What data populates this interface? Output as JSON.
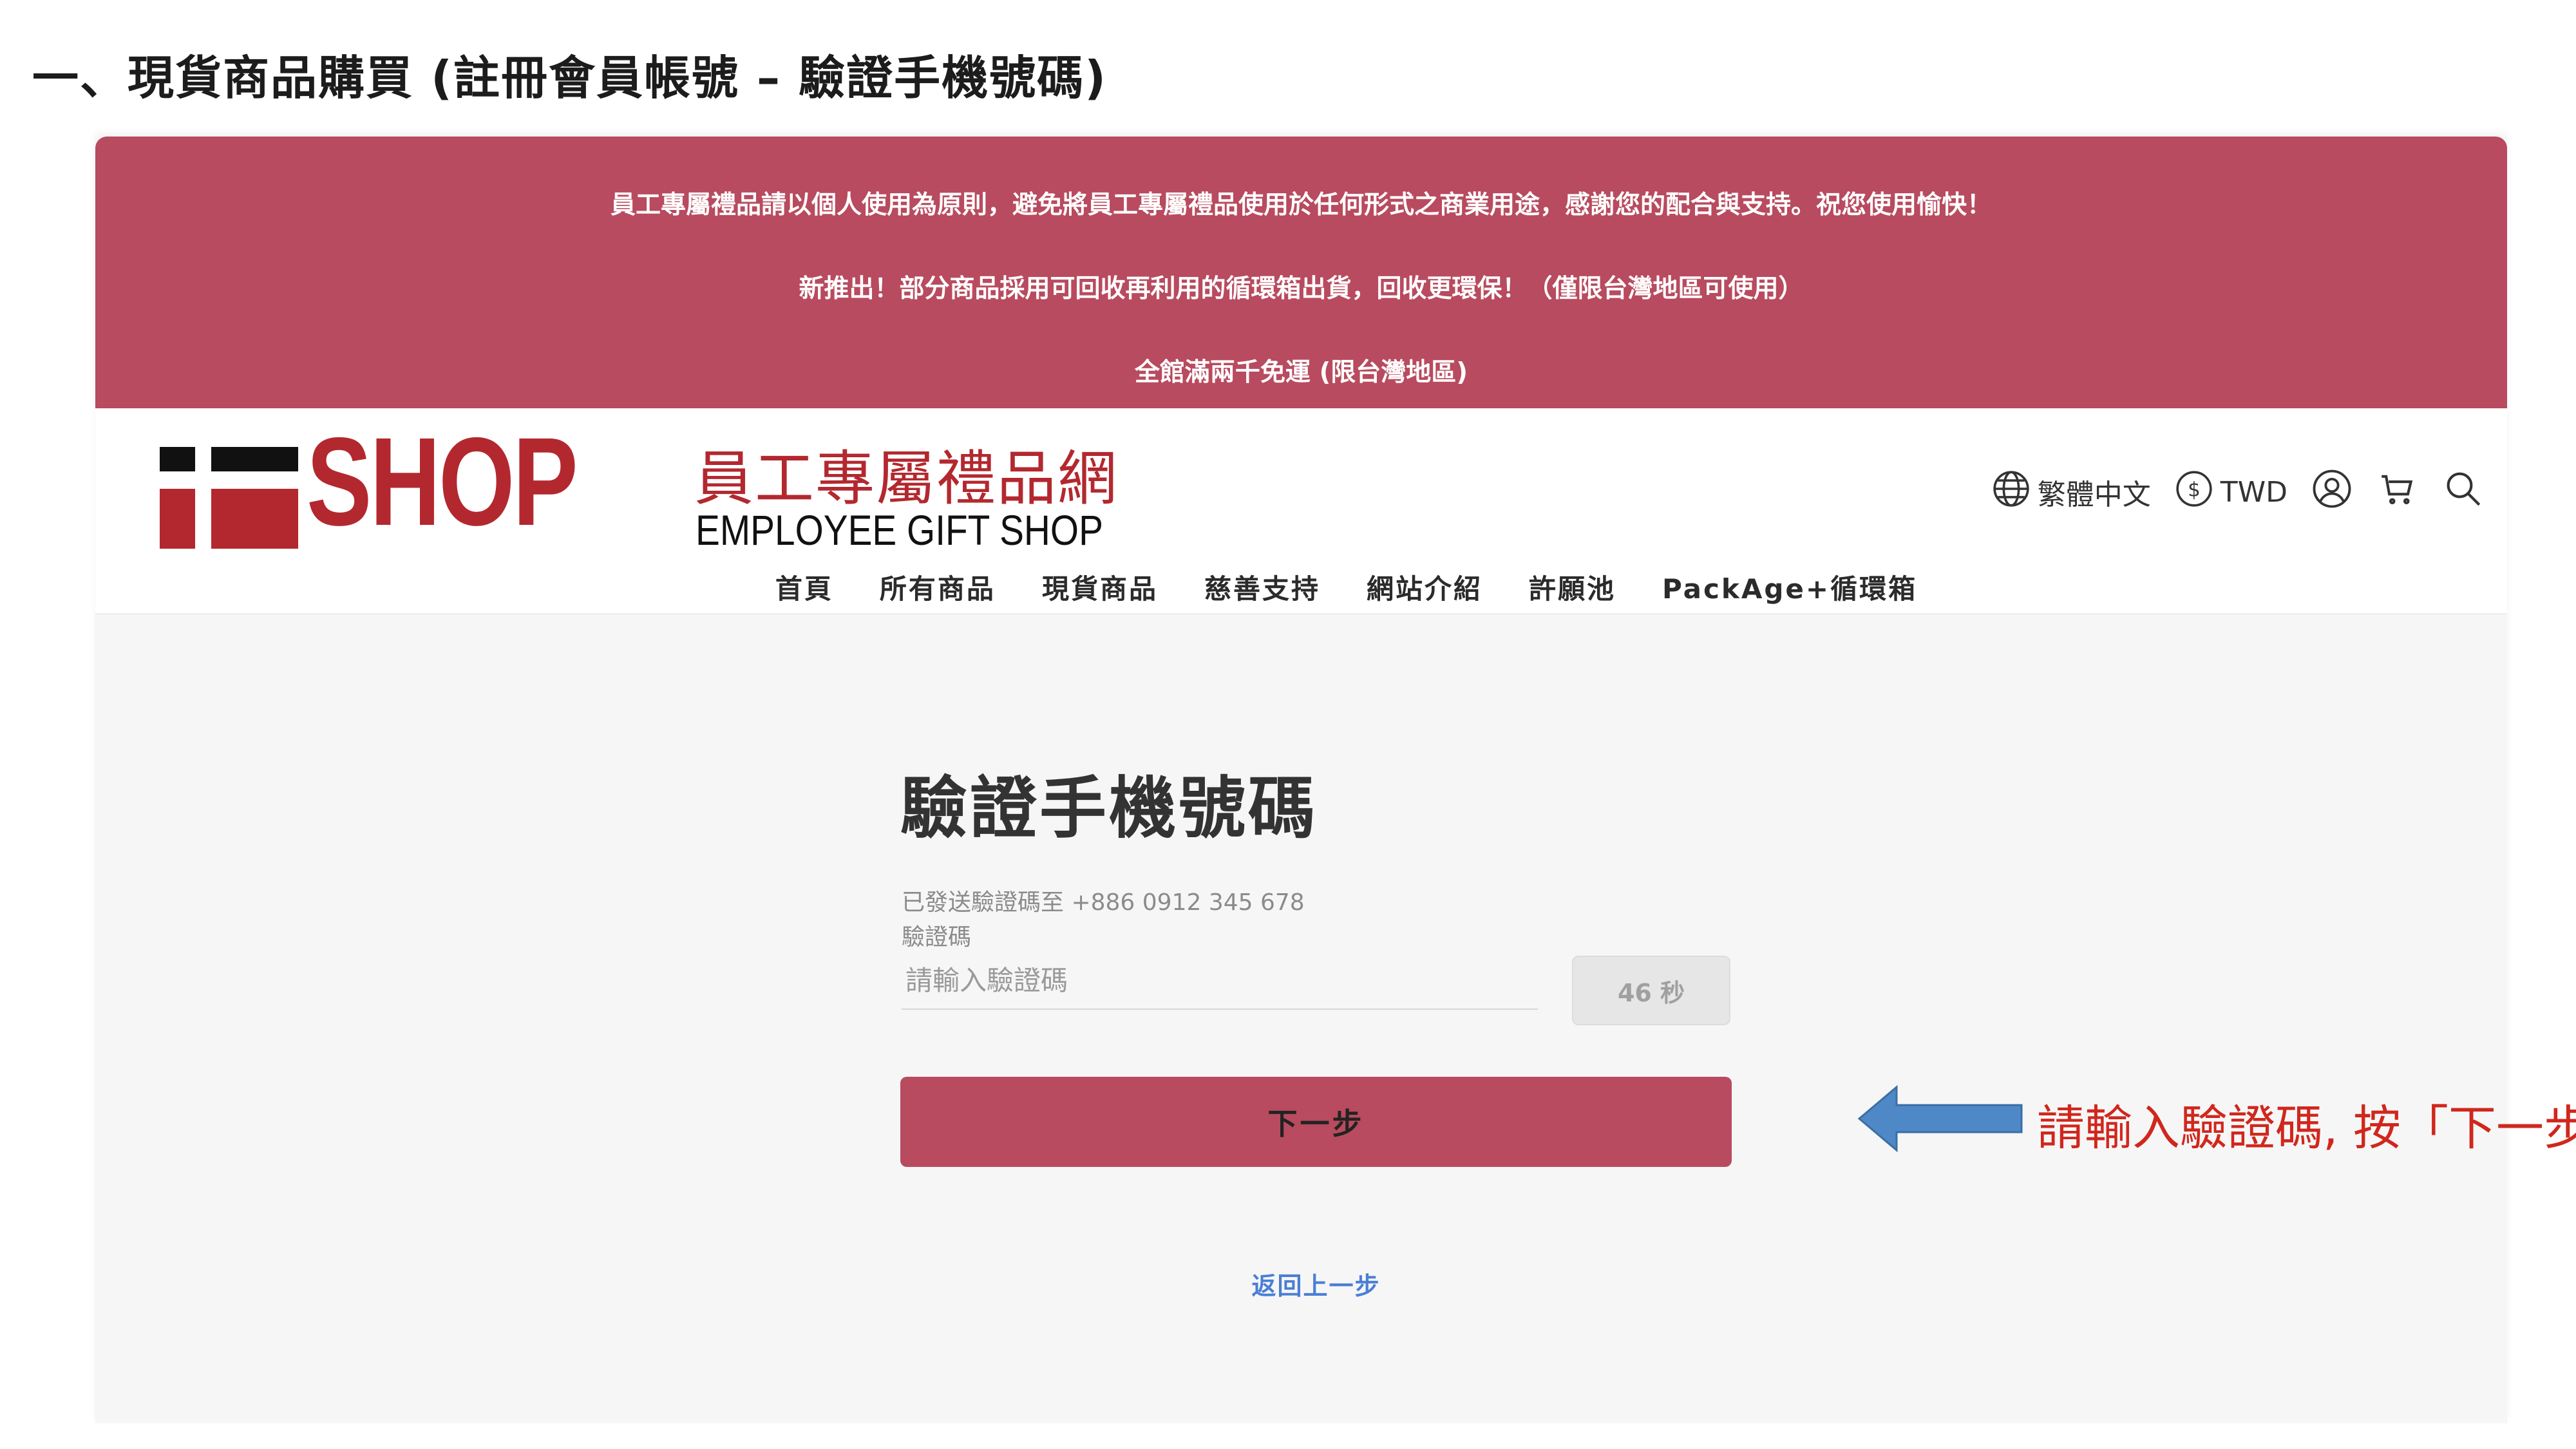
{
  "doc": {
    "heading": "一、現貨商品購買 (註冊會員帳號 – 驗證手機號碼)"
  },
  "announcement": {
    "lines": [
      "員工專屬禮品請以個人使用為原則，避免將員工專屬禮品使用於任何形式之商業用途，感謝您的配合與支持。祝您使用愉快！",
      "新推出！部分商品採用可回收再利用的循環箱出貨，回收更環保！（僅限台灣地區可使用）",
      "全館滿兩千免運 (限台灣地區)"
    ],
    "background_color": "#b84b5f"
  },
  "header": {
    "logo": {
      "shop_text": "SHOP",
      "cn_text": "員工專屬禮品網",
      "en_text": "EMPLOYEE GIFT SHOP"
    },
    "utilities": {
      "language_label": "繁體中文",
      "currency_label": "TWD",
      "icons": [
        "globe-icon",
        "dollar-circle-icon",
        "user-icon",
        "cart-icon",
        "search-icon"
      ]
    },
    "nav": [
      "首頁",
      "所有商品",
      "現貨商品",
      "慈善支持",
      "網站介紹",
      "許願池",
      "PackAge+循環箱"
    ]
  },
  "verify_form": {
    "title": "驗證手機號碼",
    "sent_text": "已發送驗證碼至 +886 0912 345 678",
    "code_label": "驗證碼",
    "code_placeholder": "請輸入驗證碼",
    "code_value": "",
    "countdown_label": "46 秒",
    "next_label": "下一步",
    "back_label": "返回上一步"
  },
  "annotation": {
    "callout_text": "請輸入驗證碼, 按「下一步」",
    "arrow_color": "#4f88c6",
    "text_color": "#d0271d"
  }
}
